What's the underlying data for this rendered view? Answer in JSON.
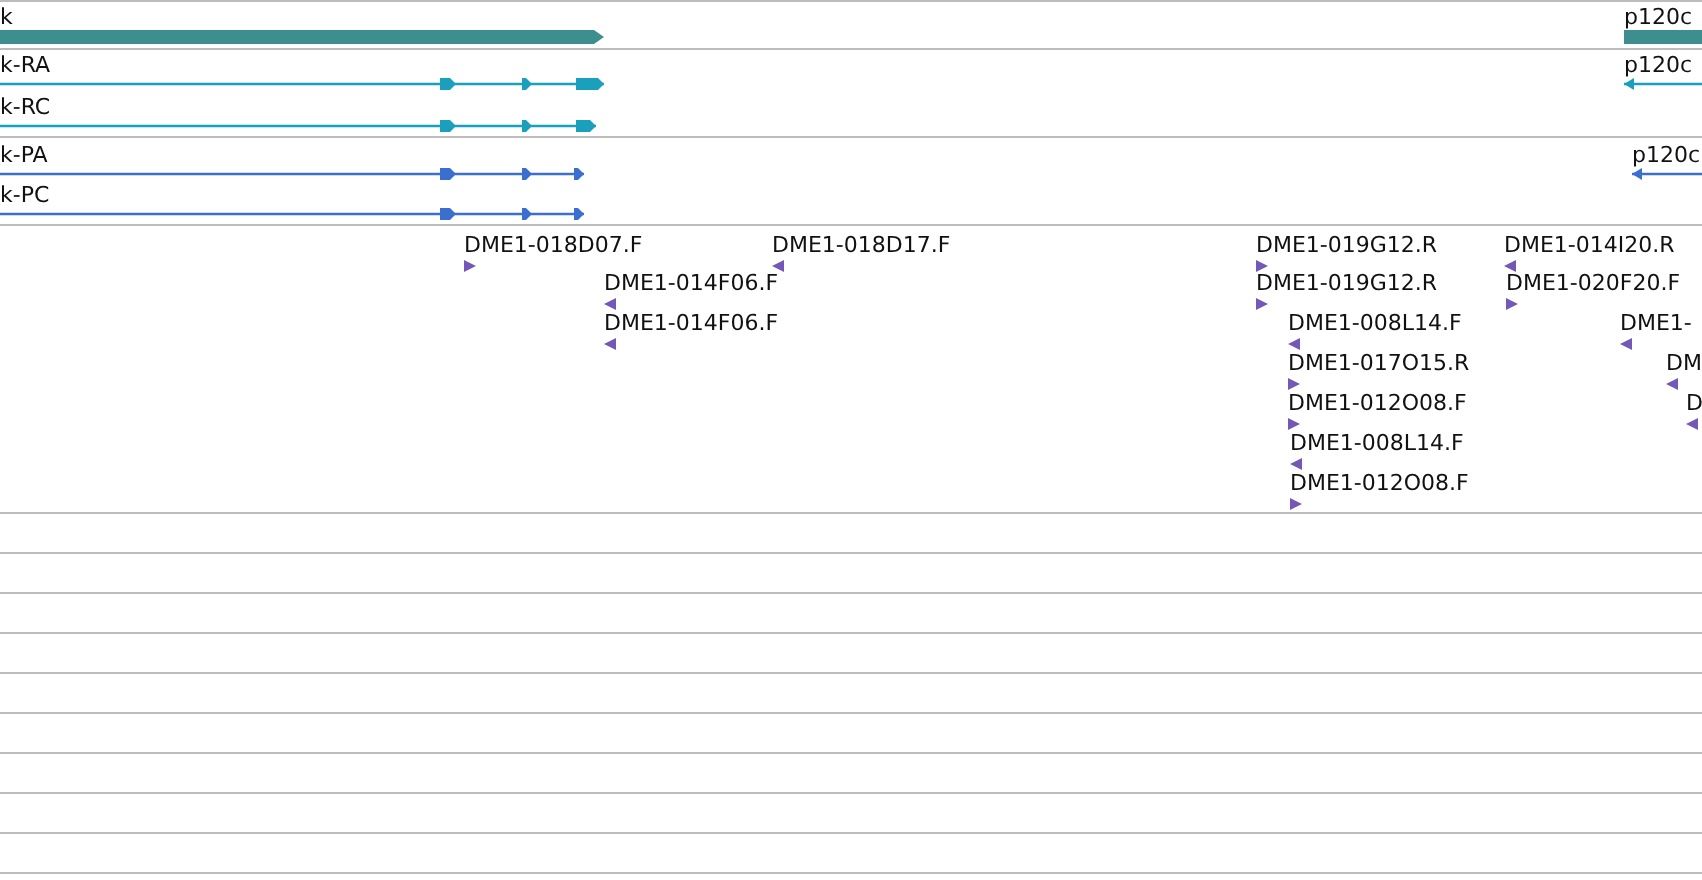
{
  "gene_track": {
    "genes": [
      {
        "name": "k"
      },
      {
        "name": "p120c"
      }
    ]
  },
  "transcript_track": {
    "transcripts": [
      {
        "name": "k-RA"
      },
      {
        "name": "k-RC"
      },
      {
        "name": "p120c"
      }
    ]
  },
  "protein_track": {
    "proteins": [
      {
        "name": "k-PA"
      },
      {
        "name": "k-PC"
      },
      {
        "name": "p120c"
      }
    ]
  },
  "est_track": {
    "features": [
      {
        "name": "DME1-018D07.F",
        "reverse": false
      },
      {
        "name": "DME1-018D17.F",
        "reverse": true
      },
      {
        "name": "DME1-014F06.F",
        "reverse": true
      },
      {
        "name": "DME1-014F06.F",
        "reverse": true
      },
      {
        "name": "DME1-019G12.R",
        "reverse": false
      },
      {
        "name": "DME1-019G12.R",
        "reverse": false
      },
      {
        "name": "DME1-008L14.F",
        "reverse": true
      },
      {
        "name": "DME1-017O15.R",
        "reverse": false
      },
      {
        "name": "DME1-012O08.F",
        "reverse": false
      },
      {
        "name": "DME1-008L14.F",
        "reverse": true
      },
      {
        "name": "DME1-012O08.F",
        "reverse": false
      },
      {
        "name": "DME1-014I20.R",
        "reverse": true
      },
      {
        "name": "DME1-020F20.F",
        "reverse": false
      },
      {
        "name": "DME1-",
        "reverse": true
      },
      {
        "name": "DM",
        "reverse": true
      },
      {
        "name": "D",
        "reverse": true
      }
    ]
  }
}
